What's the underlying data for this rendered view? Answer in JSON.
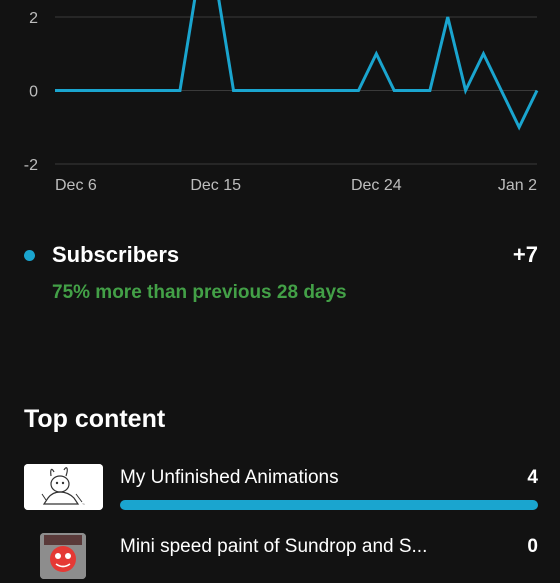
{
  "chart_data": {
    "type": "line",
    "color": "#1aa5cf",
    "y_ticks": [
      "2",
      "0",
      "-2"
    ],
    "y_tick_values": [
      2,
      0,
      -2
    ],
    "ylim": [
      -2.3,
      2.6
    ],
    "x_tick_labels": [
      "Dec 6",
      "Dec 15",
      "Dec 24",
      "Jan 2"
    ],
    "x_tick_index": [
      0,
      9,
      18,
      27
    ],
    "x": [
      "Dec 6",
      "Dec 7",
      "Dec 8",
      "Dec 9",
      "Dec 10",
      "Dec 11",
      "Dec 12",
      "Dec 13",
      "Dec 14",
      "Dec 15",
      "Dec 16",
      "Dec 17",
      "Dec 18",
      "Dec 19",
      "Dec 20",
      "Dec 21",
      "Dec 22",
      "Dec 23",
      "Dec 24",
      "Dec 25",
      "Dec 26",
      "Dec 27",
      "Dec 28",
      "Dec 29",
      "Dec 30",
      "Dec 31",
      "Jan 1",
      "Jan 2"
    ],
    "y": [
      0,
      0,
      0,
      0,
      0,
      0,
      0,
      0,
      3,
      3,
      0,
      0,
      0,
      0,
      0,
      0,
      0,
      0,
      1,
      0,
      0,
      0,
      2,
      0,
      1,
      0,
      -1,
      0
    ],
    "grid": true
  },
  "metric": {
    "title": "Subscribers",
    "value": "+7",
    "comparison": "75% more than previous 28 days"
  },
  "top_content": {
    "title": "Top content",
    "items": [
      {
        "title": "My Unfinished Animations",
        "count": "4",
        "share": 1.0
      },
      {
        "title": "Mini speed paint of Sundrop and S...",
        "count": "0",
        "share": 0.0
      }
    ]
  }
}
